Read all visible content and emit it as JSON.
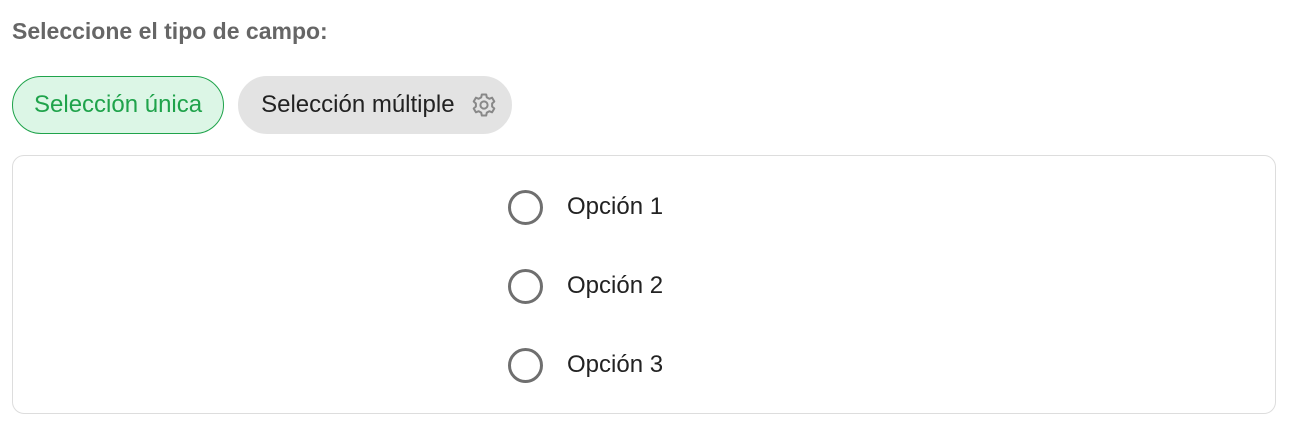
{
  "field_type": {
    "label": "Seleccione el tipo de campo:",
    "chips": {
      "single": {
        "label": "Selección única",
        "selected": true
      },
      "multiple": {
        "label": "Selección múltiple",
        "selected": false,
        "icon": "gear-icon"
      }
    }
  },
  "colors": {
    "selected_chip_bg": "#dcf6e6",
    "selected_chip_accent": "#1fa34b",
    "unselected_chip_bg": "#e3e3e3"
  },
  "options": [
    {
      "label": "Opción 1",
      "checked": false
    },
    {
      "label": "Opción 2",
      "checked": false
    },
    {
      "label": "Opción 3",
      "checked": false
    }
  ]
}
